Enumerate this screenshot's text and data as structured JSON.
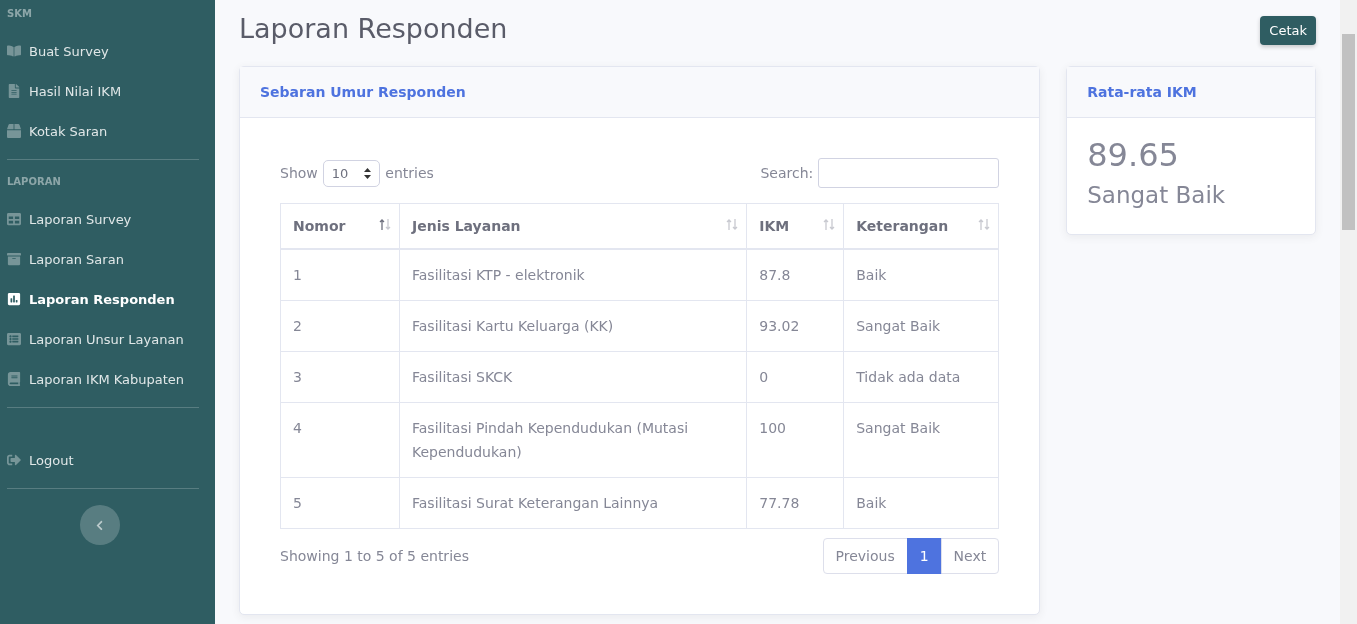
{
  "sidebar": {
    "sections": [
      {
        "heading": "SKM",
        "items": [
          {
            "label": "Buat Survey",
            "selected": false
          },
          {
            "label": "Hasil Nilai IKM",
            "selected": false
          },
          {
            "label": "Kotak Saran",
            "selected": false
          }
        ]
      },
      {
        "heading": "LAPORAN",
        "items": [
          {
            "label": "Laporan Survey",
            "selected": false
          },
          {
            "label": "Laporan Saran",
            "selected": false
          },
          {
            "label": "Laporan Responden",
            "selected": true
          },
          {
            "label": "Laporan Unsur Layanan",
            "selected": false
          },
          {
            "label": "Laporan IKM Kabupaten",
            "selected": false
          }
        ]
      }
    ],
    "logout": "Logout"
  },
  "page": {
    "title": "Laporan Responden",
    "print_button": "Cetak"
  },
  "main_card": {
    "title": "Sebaran Umur Responden",
    "show_label": "Show",
    "entries_value": "10",
    "entries_label": "entries",
    "search_label": "Search:",
    "columns": [
      {
        "label": "Nomor",
        "sorted": true
      },
      {
        "label": "Jenis Layanan",
        "sorted": false
      },
      {
        "label": "IKM",
        "sorted": false
      },
      {
        "label": "Keterangan",
        "sorted": false
      }
    ],
    "rows": [
      [
        "1",
        "Fasilitasi KTP - elektronik",
        "87.8",
        "Baik"
      ],
      [
        "2",
        "Fasilitasi Kartu Keluarga (KK)",
        "93.02",
        "Sangat Baik"
      ],
      [
        "3",
        "Fasilitasi SKCK",
        "0",
        "Tidak ada data"
      ],
      [
        "4",
        "Fasilitasi Pindah Kependudukan (Mutasi Kependudukan)",
        "100",
        "Sangat Baik"
      ],
      [
        "5",
        "Fasilitasi Surat Keterangan Lainnya",
        "77.78",
        "Baik"
      ]
    ],
    "info": "Showing 1 to 5 of 5 entries",
    "pagination": [
      {
        "label": "Previous",
        "selected": false,
        "disabled": true
      },
      {
        "label": "1",
        "selected": true,
        "disabled": false
      },
      {
        "label": "Next",
        "selected": false,
        "disabled": true
      }
    ]
  },
  "side_card": {
    "title": "Rata-rata IKM",
    "value": "89.65",
    "rating": "Sangat Baik"
  }
}
